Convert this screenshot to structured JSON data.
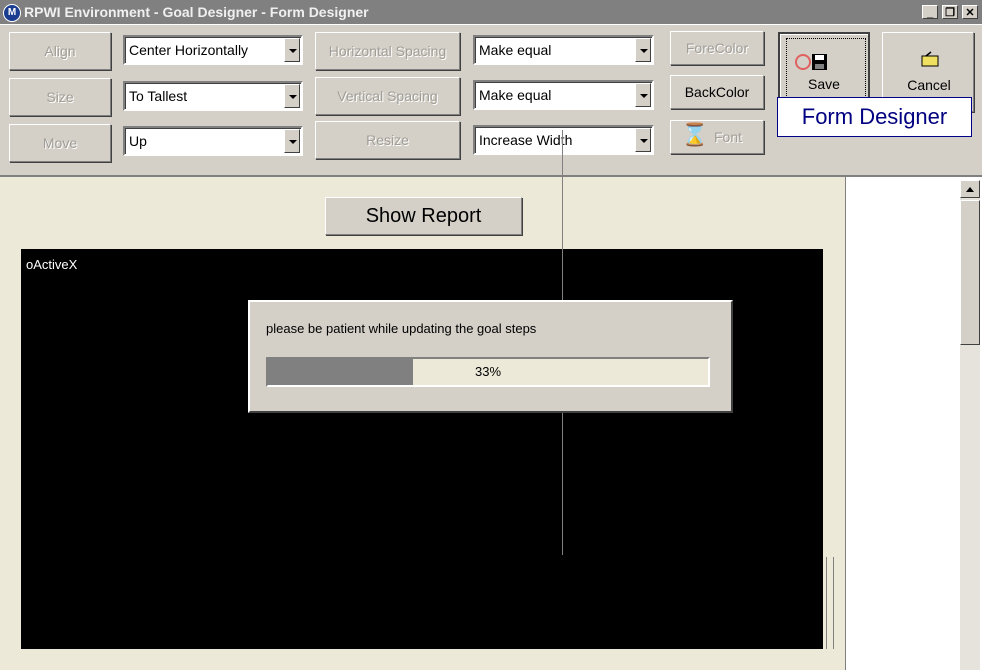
{
  "window": {
    "title": "RPWI Environment - Goal Designer - Form Designer",
    "minimize_label": "_",
    "restore_label": "❐",
    "close_label": "✕"
  },
  "toolbar": {
    "align_label": "Align",
    "size_label": "Size",
    "move_label": "Move",
    "align_value": "Center Horizontally",
    "size_value": "To Tallest",
    "move_value": "Up",
    "horizontal_spacing_label": "Horizontal Spacing",
    "vertical_spacing_label": "Vertical Spacing",
    "resize_label": "Resize",
    "horizontal_spacing_value": "Make equal",
    "vertical_spacing_value": "Make equal",
    "resize_value": "Increase Width",
    "forecolor_label": "ForeColor",
    "backcolor_label": "BackColor",
    "font_label": "Font",
    "save_label": "Save",
    "cancel_label": "Cancel",
    "caption": "Form Designer"
  },
  "form": {
    "show_report_label": "Show Report",
    "activex_label": "oActiveX"
  },
  "progress_dialog": {
    "message": "please be patient while updating the goal steps",
    "percent_text": "33%",
    "progress": 0.33
  },
  "colors": {
    "caption_text": "#000080",
    "progress_fill": "#808080"
  },
  "icons": {
    "save": "floppy-disk-icon",
    "cancel": "folder-icon",
    "font": "hourglass-icon"
  }
}
